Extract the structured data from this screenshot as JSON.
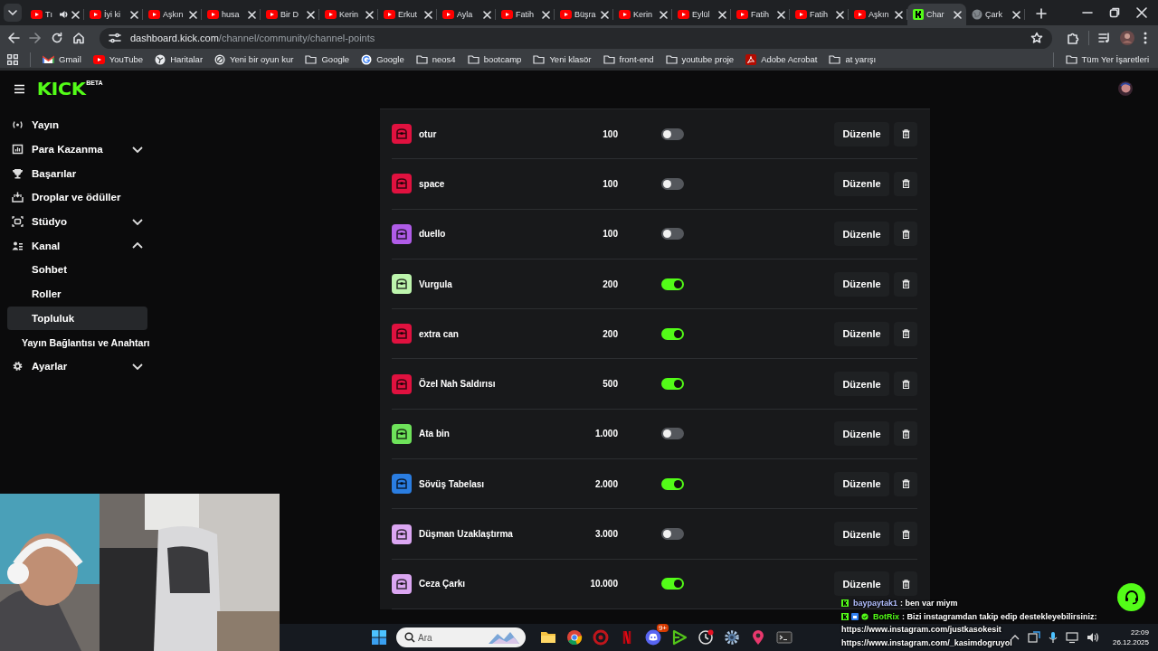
{
  "browser": {
    "tabs": [
      {
        "label": "Tı",
        "kind": "youtube",
        "audio": true,
        "selected": false
      },
      {
        "label": "İyi ki",
        "kind": "youtube",
        "audio": false,
        "selected": false
      },
      {
        "label": "Aşkın",
        "kind": "youtube",
        "audio": false,
        "selected": false
      },
      {
        "label": "husa",
        "kind": "youtube",
        "audio": false,
        "selected": false
      },
      {
        "label": "Bir D",
        "kind": "youtube",
        "audio": false,
        "selected": false
      },
      {
        "label": "Kerin",
        "kind": "youtube",
        "audio": false,
        "selected": false
      },
      {
        "label": "Erkut",
        "kind": "youtube",
        "audio": false,
        "selected": false
      },
      {
        "label": "Ayla",
        "kind": "youtube",
        "audio": false,
        "selected": false
      },
      {
        "label": "Fatih",
        "kind": "youtube",
        "audio": false,
        "selected": false
      },
      {
        "label": "Büşra",
        "kind": "youtube",
        "audio": false,
        "selected": false
      },
      {
        "label": "Kerin",
        "kind": "youtube",
        "audio": false,
        "selected": false
      },
      {
        "label": "Eylül",
        "kind": "youtube",
        "audio": false,
        "selected": false
      },
      {
        "label": "Fatih",
        "kind": "youtube",
        "audio": false,
        "selected": false
      },
      {
        "label": "Fatih",
        "kind": "youtube",
        "audio": false,
        "selected": false
      },
      {
        "label": "Aşkın",
        "kind": "youtube",
        "audio": false,
        "selected": false
      },
      {
        "label": "Char",
        "kind": "kick",
        "audio": false,
        "selected": true
      },
      {
        "label": "Çark",
        "kind": "globe",
        "audio": false,
        "selected": false
      }
    ],
    "address": {
      "domain": "dashboard.kick.com",
      "path": "/channel/community/channel-points"
    },
    "bookmarks": [
      {
        "label": "Gmail",
        "kind": "gmail"
      },
      {
        "label": "YouTube",
        "kind": "youtube"
      },
      {
        "label": "Haritalar",
        "kind": "maps"
      },
      {
        "label": "Yeni bir oyun kur",
        "kind": "site"
      },
      {
        "label": "Google",
        "kind": "folder"
      },
      {
        "label": "Google",
        "kind": "google"
      },
      {
        "label": "neos4",
        "kind": "folder"
      },
      {
        "label": "bootcamp",
        "kind": "folder"
      },
      {
        "label": "Yeni klasör",
        "kind": "folder"
      },
      {
        "label": "front-end",
        "kind": "folder"
      },
      {
        "label": "youtube proje",
        "kind": "folder"
      },
      {
        "label": "Adobe Acrobat",
        "kind": "acrobat"
      },
      {
        "label": "at yarışı",
        "kind": "folder"
      }
    ],
    "all_bookmarks": "Tüm Yer İşaretleri"
  },
  "header": {
    "logo": "KICK",
    "badge": "BETA"
  },
  "sidebar": {
    "items": [
      {
        "label": "Yayın",
        "kind": "broadcast",
        "selected": false
      },
      {
        "label": "Para Kazanma",
        "kind": "chart",
        "expanded": false,
        "selected": false
      },
      {
        "label": "Başarılar",
        "kind": "trophy",
        "selected": false
      },
      {
        "label": "Droplar ve ödüller",
        "kind": "drop",
        "selected": false
      },
      {
        "label": "Stüdyo",
        "kind": "studio",
        "expanded": false,
        "selected": false
      },
      {
        "label": "Kanal",
        "kind": "people",
        "expanded": true,
        "selected": false,
        "children": [
          {
            "label": "Sohbet",
            "selected": false
          },
          {
            "label": "Roller",
            "selected": false
          },
          {
            "label": "Topluluk",
            "selected": true
          }
        ]
      },
      {
        "label": "Yayın Bağlantısı ve Anahtarı",
        "kind": "link",
        "selected": false
      },
      {
        "label": "Ayarlar",
        "kind": "gear",
        "expanded": false,
        "selected": false
      }
    ]
  },
  "rewards": [
    {
      "name": "otur",
      "cost": "100",
      "enabled": false,
      "color": "#e0113f",
      "edit_label": "Düzenle"
    },
    {
      "name": "space",
      "cost": "100",
      "enabled": false,
      "color": "#e0113f",
      "edit_label": "Düzenle"
    },
    {
      "name": "duello",
      "cost": "100",
      "enabled": false,
      "color": "#b05ce8",
      "edit_label": "Düzenle"
    },
    {
      "name": "Vurgula",
      "cost": "200",
      "enabled": true,
      "color": "#bdf5ad",
      "edit_label": "Düzenle"
    },
    {
      "name": "extra can",
      "cost": "200",
      "enabled": true,
      "color": "#e0113f",
      "edit_label": "Düzenle"
    },
    {
      "name": "Özel Nah Saldırısı",
      "cost": "500",
      "enabled": true,
      "color": "#e0113f",
      "edit_label": "Düzenle"
    },
    {
      "name": "Ata bin",
      "cost": "1.000",
      "enabled": false,
      "color": "#6ee25a",
      "edit_label": "Düzenle"
    },
    {
      "name": "Sövüş Tabelası",
      "cost": "2.000",
      "enabled": true,
      "color": "#2a7de1",
      "edit_label": "Düzenle"
    },
    {
      "name": "Düşman Uzaklaştırma",
      "cost": "3.000",
      "enabled": false,
      "color": "#dba6f2",
      "edit_label": "Düzenle"
    },
    {
      "name": "Ceza Çarkı",
      "cost": "10.000",
      "enabled": true,
      "color": "#dba6f2",
      "edit_label": "Düzenle"
    }
  ],
  "chat": [
    {
      "user": "baypaytak1",
      "color": "#b3bfff",
      "kind": "viewer",
      "lines": [
        ": ben var miym"
      ]
    },
    {
      "user": "BotRix",
      "color": "#53fc18",
      "kind": "bot",
      "lines": [
        ": Bizi instagramdan takip edip destekleyebilirsiniz:",
        "https://www.instagram.com/justkasokesit",
        "https://www.instagram.com/_kasimdogruyol"
      ]
    }
  ],
  "taskbar": {
    "search_placeholder": "Ara",
    "apps": [
      {
        "kind": "explorer"
      },
      {
        "kind": "chrome"
      },
      {
        "kind": "redcircle"
      },
      {
        "kind": "netflix"
      },
      {
        "kind": "discord",
        "badge": "9+"
      },
      {
        "kind": "play"
      },
      {
        "kind": "clock"
      },
      {
        "kind": "gear"
      },
      {
        "kind": "pin"
      },
      {
        "kind": "terminal"
      }
    ],
    "time": "22:09",
    "date": "26.12.2025"
  }
}
